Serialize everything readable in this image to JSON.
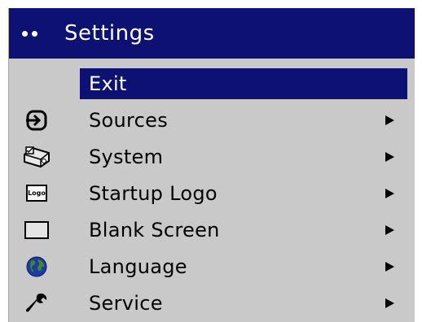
{
  "header": {
    "title": "Settings"
  },
  "menu": {
    "items": [
      {
        "label": "Exit",
        "icon": "",
        "has_submenu": false,
        "selected": true
      },
      {
        "label": "Sources",
        "icon": "source-input-icon",
        "has_submenu": true,
        "selected": false
      },
      {
        "label": "System",
        "icon": "system-projector-icon",
        "has_submenu": true,
        "selected": false
      },
      {
        "label": "Startup Logo",
        "icon": "logo-icon",
        "icon_text": "Logo",
        "has_submenu": true,
        "selected": false
      },
      {
        "label": "Blank Screen",
        "icon": "blank-screen-icon",
        "has_submenu": true,
        "selected": false
      },
      {
        "label": "Language",
        "icon": "globe-icon",
        "has_submenu": true,
        "selected": false
      },
      {
        "label": "Service",
        "icon": "wrench-icon",
        "has_submenu": true,
        "selected": false
      }
    ]
  },
  "colors": {
    "header_bg": "#0d1272",
    "menu_bg": "#c9c9c9",
    "highlight_bg": "#0d1272",
    "text": "#000000",
    "highlight_text": "#ffffff"
  }
}
